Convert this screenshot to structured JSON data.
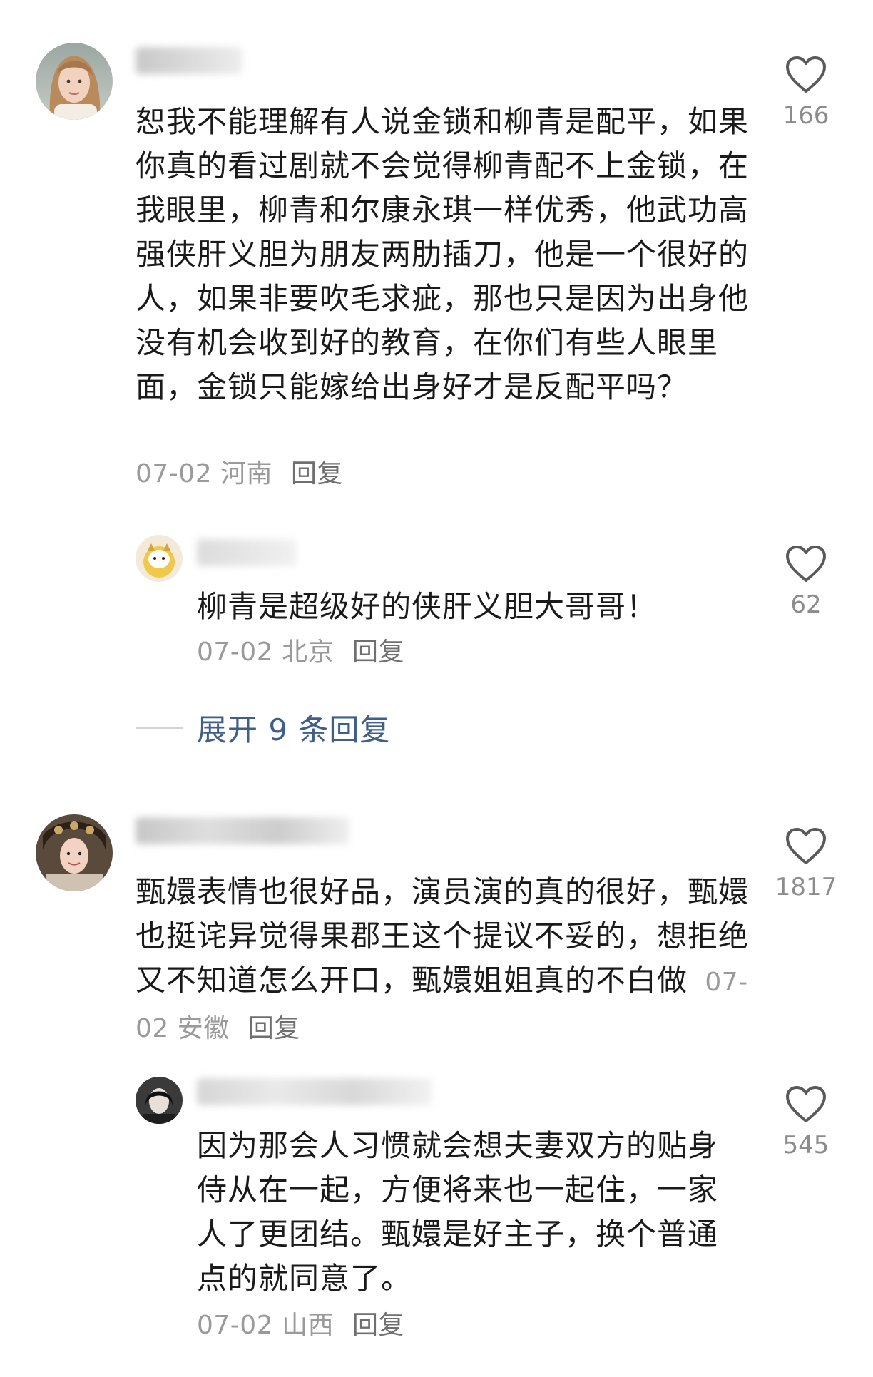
{
  "comments": [
    {
      "text": "恕我不能理解有人说金锁和柳青是配平，如果你真的看过剧就不会觉得柳青配不上金锁，在我眼里，柳青和尔康永琪一样优秀，他武功高强侠肝义胆为朋友两肋插刀，他是一个很好的人，如果非要吹毛求疵，那也只是因为出身他没有机会收到好的教育，在你们有些人眼里面，金锁只能嫁给出身好才是反配平吗？",
      "date": "07-02",
      "location": "河南",
      "reply_label": "回复",
      "likes": "166"
    },
    {
      "text": "甄嬛表情也很好品，演员演的真的很好，甄嬛也挺诧异觉得果郡王这个提议不妥的，想拒绝又不知道怎么开口，甄嬛姐姐真的不白做",
      "date": "07-02",
      "location": "安徽",
      "reply_label": "回复",
      "likes": "1817"
    }
  ],
  "replies": [
    {
      "text": "柳青是超级好的侠肝义胆大哥哥！",
      "date": "07-02",
      "location": "北京",
      "reply_label": "回复",
      "likes": "62"
    },
    {
      "text": "因为那会人习惯就会想夫妻双方的贴身侍从在一起，方便将来也一起住，一家人了更团结。甄嬛是好主子，换个普通点的就同意了。",
      "date": "07-02",
      "location": "山西",
      "reply_label": "回复",
      "likes": "545"
    }
  ],
  "expand_replies": {
    "label": "展开 9 条回复"
  },
  "icons": {
    "like": "heart-outline-icon"
  },
  "colors": {
    "link": "#3f5f8a",
    "meta": "#9a9a9a",
    "text": "#1a1a1a"
  }
}
